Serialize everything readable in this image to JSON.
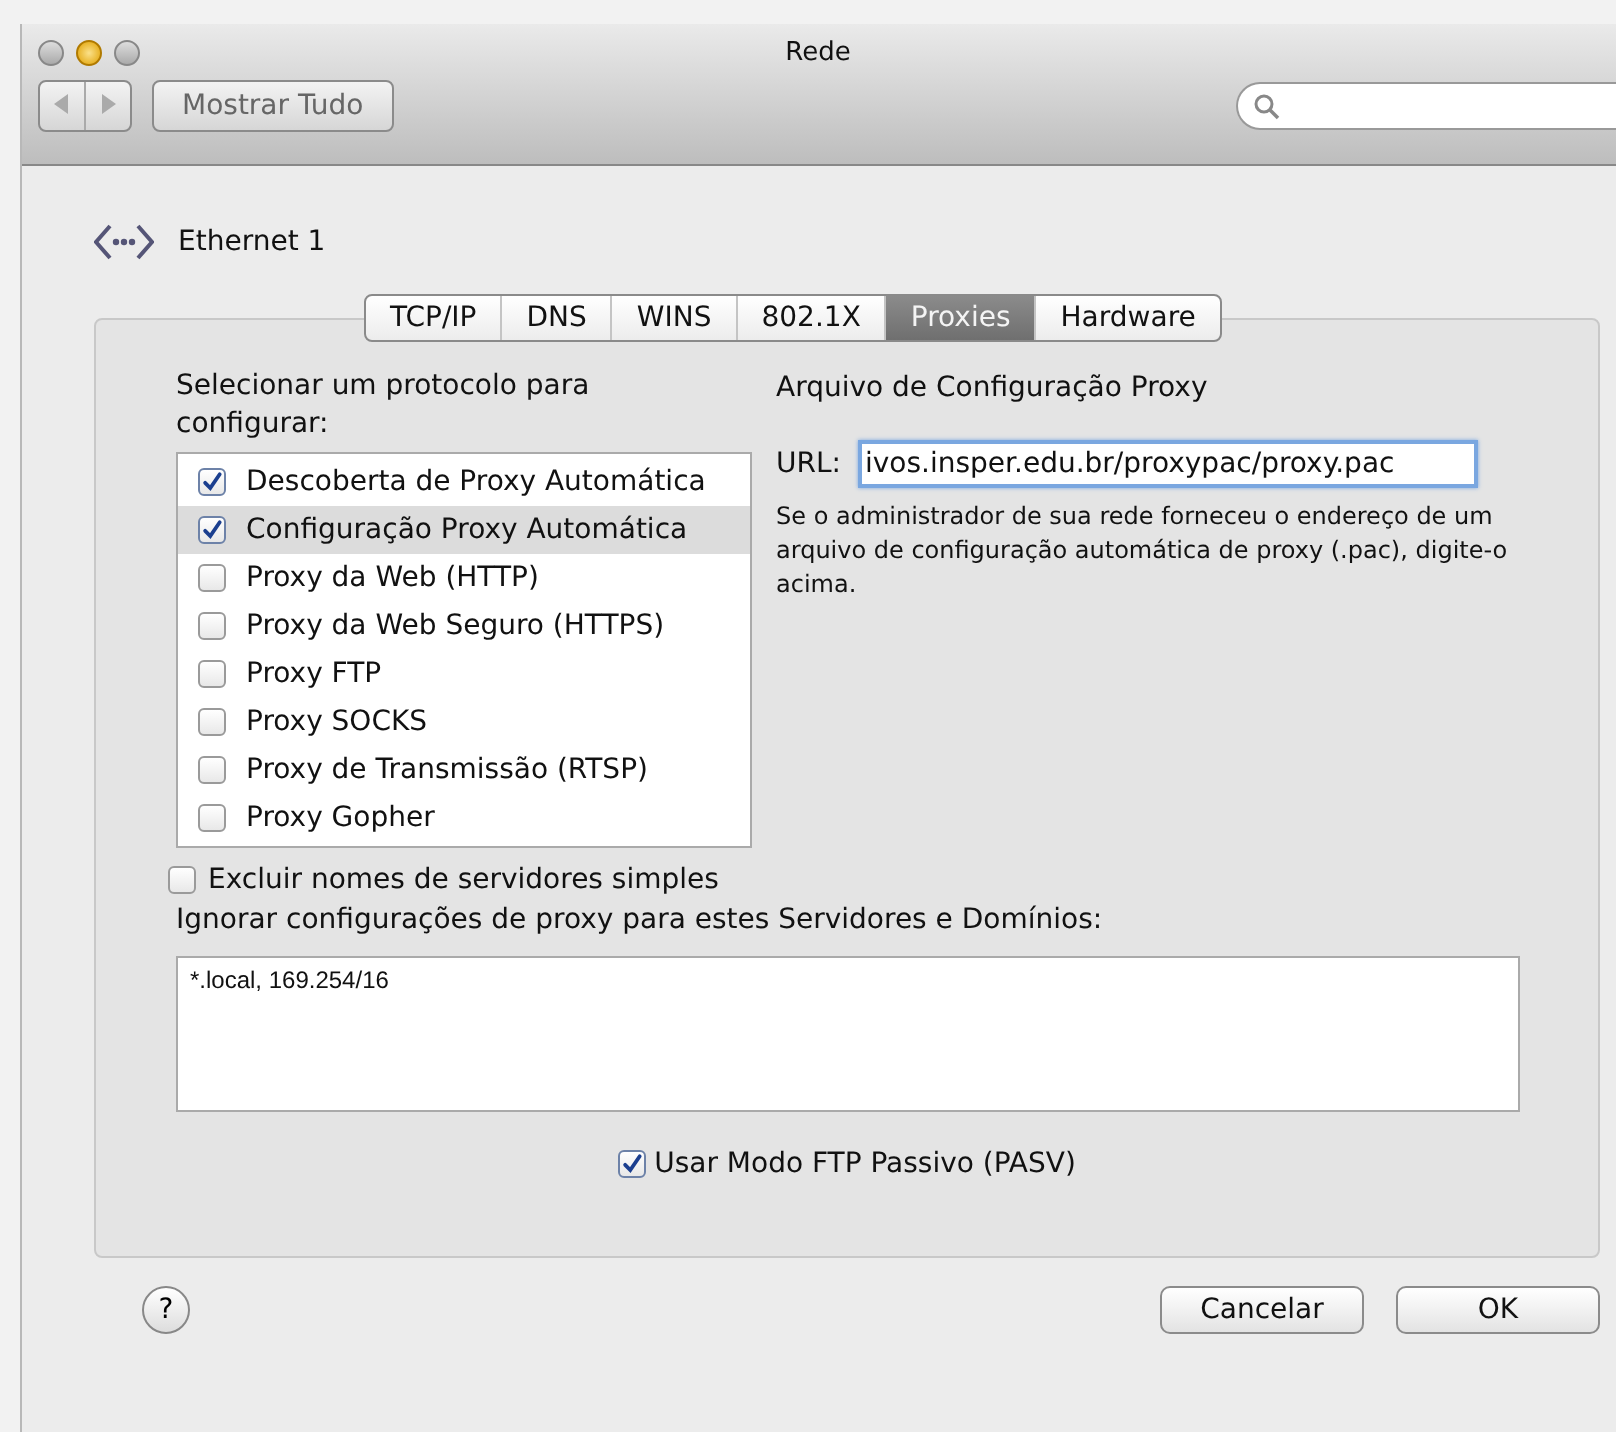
{
  "window": {
    "title": "Rede",
    "show_all": "Mostrar Tudo"
  },
  "service": {
    "name": "Ethernet 1"
  },
  "tabs": [
    {
      "label": "TCP/IP",
      "selected": false
    },
    {
      "label": "DNS",
      "selected": false
    },
    {
      "label": "WINS",
      "selected": false
    },
    {
      "label": "802.1X",
      "selected": false
    },
    {
      "label": "Proxies",
      "selected": true
    },
    {
      "label": "Hardware",
      "selected": false
    }
  ],
  "protocols": {
    "label": "Selecionar um protocolo para configurar:",
    "items": [
      {
        "label": "Descoberta de Proxy Automática",
        "checked": true,
        "selected": false
      },
      {
        "label": "Configuração Proxy Automática",
        "checked": true,
        "selected": true
      },
      {
        "label": "Proxy da Web (HTTP)",
        "checked": false,
        "selected": false
      },
      {
        "label": "Proxy da Web Seguro (HTTPS)",
        "checked": false,
        "selected": false
      },
      {
        "label": "Proxy FTP",
        "checked": false,
        "selected": false
      },
      {
        "label": "Proxy SOCKS",
        "checked": false,
        "selected": false
      },
      {
        "label": "Proxy de Transmissão (RTSP)",
        "checked": false,
        "selected": false
      },
      {
        "label": "Proxy Gopher",
        "checked": false,
        "selected": false
      }
    ]
  },
  "pac": {
    "title": "Arquivo de Configuração Proxy",
    "url_label": "URL:",
    "url": "ivos.insper.edu.br/proxypac/proxy.pac",
    "help": "Se o administrador de sua rede forneceu o endereço de um arquivo de configuração automática de proxy (.pac), digite-o acima."
  },
  "exclude_simple": {
    "label": "Excluir nomes de servidores simples",
    "checked": false
  },
  "bypass": {
    "label": "Ignorar configurações de proxy para estes Servidores e Domínios:",
    "value": "*.local, 169.254/16"
  },
  "passive_ftp": {
    "label": "Usar Modo FTP Passivo (PASV)",
    "checked": true
  },
  "help_button": "?",
  "buttons": [
    "Cancelar",
    "OK"
  ]
}
